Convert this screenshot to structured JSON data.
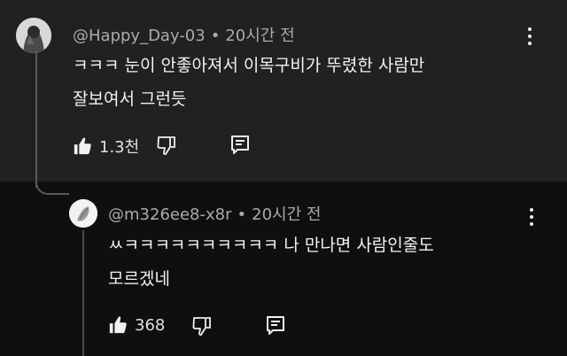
{
  "comments": [
    {
      "author": "@Happy_Day-03",
      "separator": "•",
      "time": "20시간 전",
      "lines": [
        "ㅋㅋㅋ 눈이 안좋아져서 이목구비가 뚜렸한 사람만",
        "잘보여서 그런듯"
      ],
      "likes": "1.3천",
      "avatar_icon": "user-avatar-icon"
    },
    {
      "author": "@m326ee8-x8r",
      "separator": "•",
      "time": "20시간 전",
      "lines": [
        "ㅆㅋㅋㅋㅋㅋㅋㅋㅋㅋㅋ 나 만나면 사람인줄도",
        "모르겠네"
      ],
      "likes": "368",
      "avatar_icon": "user-avatar-icon"
    }
  ],
  "icons": {
    "like": "thumbs-up-icon",
    "dislike": "thumbs-down-icon",
    "reply": "reply-icon",
    "menu": "more-vertical-icon"
  },
  "colors": {
    "top_background": "#212121",
    "reply_background": "#0f0f0f",
    "text": "#f1f1f1",
    "meta": "#aaaaaa"
  }
}
